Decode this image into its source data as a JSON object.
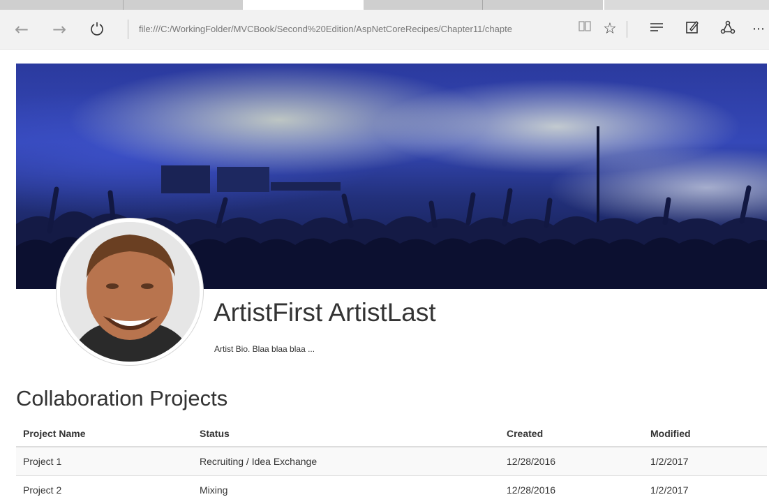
{
  "browser": {
    "address": "file:///C:/WorkingFolder/MVCBook/Second%20Edition/AspNetCoreRecipes/Chapter11/chapte",
    "icons": [
      "back-arrow-icon",
      "forward-arrow-icon",
      "refresh-icon",
      "reading-view-icon",
      "favorite-star-icon",
      "hub-icon",
      "web-note-icon",
      "share-icon",
      "more-icon"
    ]
  },
  "artist": {
    "name": "ArtistFirst ArtistLast",
    "bio": "Artist Bio. Blaa blaa blaa ..."
  },
  "projects": {
    "title": "Collaboration Projects",
    "columns": [
      "Project Name",
      "Status",
      "Created",
      "Modified"
    ],
    "rows": [
      {
        "name": "Project 1",
        "status": "Recruiting / Idea Exchange",
        "created": "12/28/2016",
        "modified": "1/2/2017"
      },
      {
        "name": "Project 2",
        "status": "Mixing",
        "created": "12/28/2016",
        "modified": "1/2/2017"
      }
    ]
  },
  "colors": {
    "banner_blue": "#3548b8",
    "crowd": "#10163e",
    "header_border": "#dddddd"
  }
}
